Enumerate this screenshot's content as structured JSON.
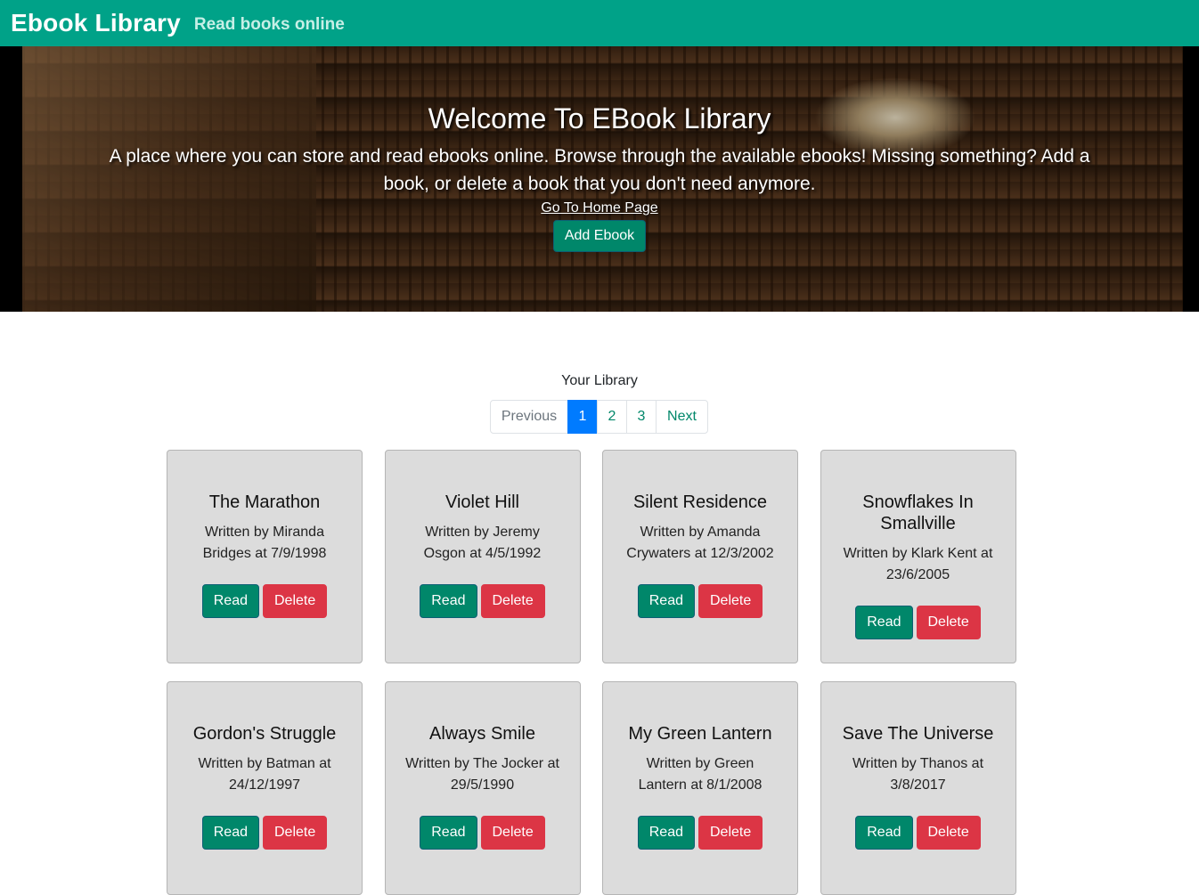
{
  "navbar": {
    "brand": "Ebook Library",
    "tagline": "Read books online"
  },
  "hero": {
    "title": "Welcome To EBook Library",
    "description": "A place where you can store and read ebooks online. Browse through the available ebooks! Missing something? Add a book, or delete a book that you don't need anymore.",
    "home_link": "Go To Home Page",
    "add_button": "Add Ebook"
  },
  "library": {
    "title": "Your Library",
    "pagination": {
      "previous": "Previous",
      "pages": [
        "1",
        "2",
        "3"
      ],
      "next": "Next",
      "active": "1"
    },
    "read_label": "Read",
    "delete_label": "Delete",
    "books": [
      {
        "title": "The Marathon",
        "byline": "Written by Miranda Bridges at 7/9/1998"
      },
      {
        "title": "Violet Hill",
        "byline": "Written by Jeremy Osgon at 4/5/1992"
      },
      {
        "title": "Silent Residence",
        "byline": "Written by Amanda Crywaters at 12/3/2002"
      },
      {
        "title": "Snowflakes In Smallville",
        "byline": "Written by Klark Kent at 23/6/2005"
      },
      {
        "title": "Gordon's Struggle",
        "byline": "Written by Batman at 24/12/1997"
      },
      {
        "title": "Always Smile",
        "byline": "Written by The Jocker at 29/5/1990"
      },
      {
        "title": "My Green Lantern",
        "byline": "Written by Green Lantern at 8/1/2008"
      },
      {
        "title": "Save The Universe",
        "byline": "Written by Thanos at 3/8/2017"
      }
    ]
  },
  "colors": {
    "navbar": "#00a288",
    "read_button": "#00876a",
    "delete_button": "#dc3545",
    "active_page": "#007bff",
    "card_background": "#dcdcdc"
  }
}
